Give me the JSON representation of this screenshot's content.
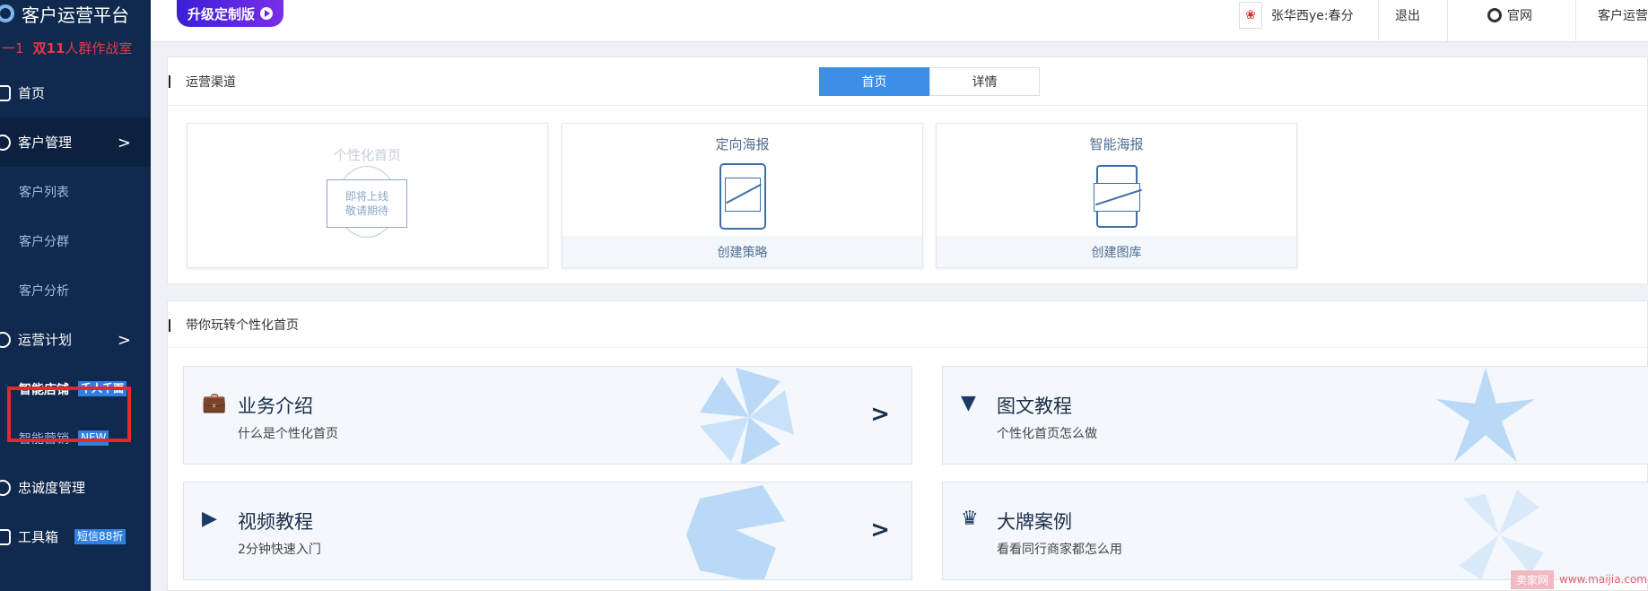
{
  "sidebar": {
    "app_title": "客户运营平台",
    "promo": {
      "prefix": "一1",
      "highlight": "双11",
      "text": "人群作战室"
    },
    "items": [
      {
        "label": "首页"
      },
      {
        "label": "客户管理",
        "chevron": ">"
      },
      {
        "label": "客户列表"
      },
      {
        "label": "客户分群"
      },
      {
        "label": "客户分析"
      },
      {
        "label": "运营计划",
        "chevron": ">"
      },
      {
        "label": "智能店铺",
        "badge": "千人千面"
      },
      {
        "label": "智能营销",
        "badge": "NEW"
      },
      {
        "label": "忠诚度管理"
      },
      {
        "label": "工具箱",
        "badge": "短信88折"
      }
    ]
  },
  "topbar": {
    "upgrade_label": "升级定制版",
    "user_name": "张华西ye:春分",
    "logout": "退出",
    "official_site": "官网",
    "right_cut": "客户运营"
  },
  "channels": {
    "title": "运营渠道",
    "tabs": [
      {
        "label": "首页",
        "active": true
      },
      {
        "label": "详情",
        "active": false
      }
    ],
    "cards": [
      {
        "title": "个性化首页",
        "stamp_line1": "即将上线",
        "stamp_line2": "敬请期待",
        "footer": ""
      },
      {
        "title": "定向海报",
        "footer": "创建策略"
      },
      {
        "title": "智能海报",
        "footer": "创建图库"
      }
    ]
  },
  "guide": {
    "title": "带你玩转个性化首页",
    "tiles": [
      {
        "name": "业务介绍",
        "desc": "什么是个性化首页",
        "icon": "briefcase-icon"
      },
      {
        "name": "图文教程",
        "desc": "个性化首页怎么做",
        "icon": "triangle-logo-icon"
      },
      {
        "name": "视频教程",
        "desc": "2分钟快速入门",
        "icon": "video-icon"
      },
      {
        "name": "大牌案例",
        "desc": "看看同行商家都怎么用",
        "icon": "crown-icon"
      }
    ]
  },
  "watermark": {
    "box": "卖家网",
    "url": "www.maijia.com"
  },
  "colors": {
    "sidebar_bg": "#10294e",
    "accent": "#3d8ee6",
    "badge": "#2f80e3",
    "highlight_box": "#e8262b"
  }
}
